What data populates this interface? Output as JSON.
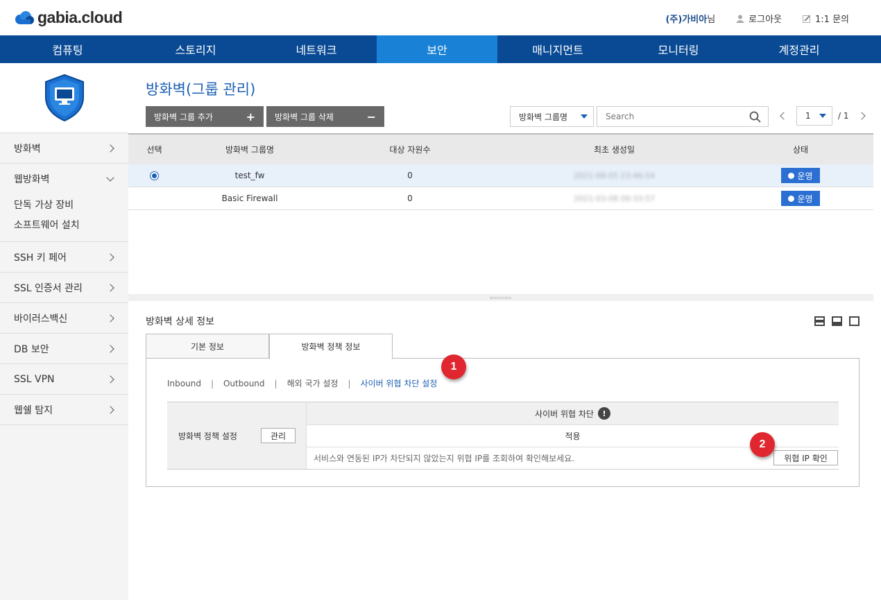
{
  "brand": {
    "logo_text": "gabia.cloud",
    "colors": {
      "primary": "#0a4a94",
      "active": "#1a82d6",
      "accent": "#1a5fb4",
      "badge": "#e0262f"
    }
  },
  "topbar": {
    "company": "(주)가비아",
    "company_suffix": "님",
    "logout": "로그아웃",
    "inquiry": "1:1 문의"
  },
  "gnb": [
    "컴퓨팅",
    "스토리지",
    "네트워크",
    "보안",
    "매니지먼트",
    "모니터링",
    "계정관리"
  ],
  "gnb_active": "보안",
  "sidebar": {
    "items": [
      {
        "label": "방화벽"
      },
      {
        "label": "웹방화벽",
        "sub": [
          "단독 가상 장비",
          "소프트웨어 설치"
        ]
      },
      {
        "label": "SSH 키 페어"
      },
      {
        "label": "SSL 인증서 관리"
      },
      {
        "label": "바이러스백신"
      },
      {
        "label": "DB 보안"
      },
      {
        "label": "SSL VPN"
      },
      {
        "label": "웹쉘 탐지"
      }
    ]
  },
  "page": {
    "title": "방화벽(그룹 관리)",
    "add_button": "방화벽 그룹 추가",
    "delete_button": "방화벽 그룹 삭제",
    "filter_select": "방화벽 그룹명",
    "search_placeholder": "Search",
    "pager": {
      "current": "1",
      "total": "/ 1"
    }
  },
  "table": {
    "columns": [
      "선택",
      "방화벽 그룹명",
      "대상 자원수",
      "최초 생성일",
      "상태"
    ],
    "rows": [
      {
        "name": "test_fw",
        "count": "0",
        "created": "2021-08-05 23:46:54",
        "status": "운영",
        "selected": true
      },
      {
        "name": "Basic Firewall",
        "count": "0",
        "created": "2021-03-08 09:33:57",
        "status": "운영",
        "selected": false
      }
    ]
  },
  "detail": {
    "title": "방화벽 상세 정보",
    "tabs": [
      "기본 정보",
      "방화벽 정책 정보"
    ],
    "subnav": [
      "Inbound",
      "Outbound",
      "해외 국가 설정",
      "사이버 위협 차단 설정"
    ],
    "policy_label": "방화벽 정책 설정",
    "manage_button": "관리",
    "cyber_header": "사이버 위협 차단",
    "apply_text": "적용",
    "message": "서비스와 연동된 IP가 차단되지 않았는지 위협 IP를 조회하여 확인해보세요.",
    "check_button": "위협 IP 확인",
    "badges": [
      "1",
      "2"
    ]
  }
}
